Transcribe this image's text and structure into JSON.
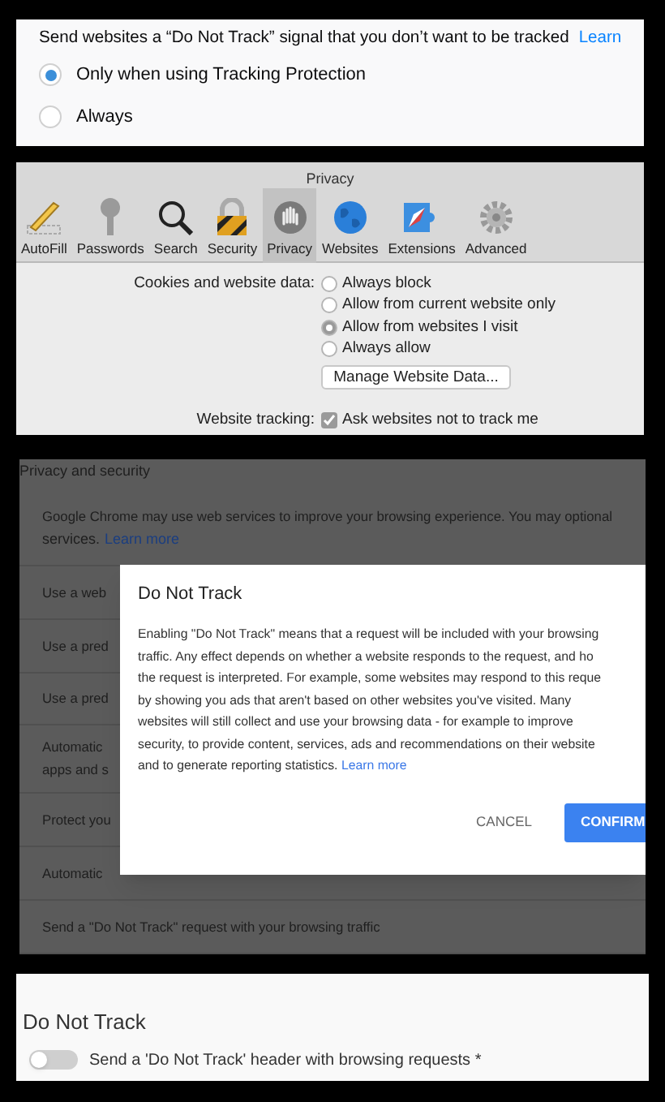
{
  "firefox": {
    "description": "Send websites a “Do Not Track” signal that you don’t want to be tracked",
    "link": "Learn",
    "options": [
      {
        "label": "Only when using Tracking Protection",
        "selected": true
      },
      {
        "label": "Always",
        "selected": false
      }
    ]
  },
  "safari": {
    "title": "Privacy",
    "tabs": [
      {
        "label": "AutoFill",
        "kind": "pencil",
        "selected": false
      },
      {
        "label": "Passwords",
        "kind": "key",
        "selected": false
      },
      {
        "label": "Search",
        "kind": "search",
        "selected": false
      },
      {
        "label": "Security",
        "kind": "lock",
        "selected": false
      },
      {
        "label": "Privacy",
        "kind": "hand",
        "selected": true
      },
      {
        "label": "Websites",
        "kind": "globe",
        "selected": false
      },
      {
        "label": "Extensions",
        "kind": "puzzle",
        "selected": false
      },
      {
        "label": "Advanced",
        "kind": "gear",
        "selected": false
      }
    ],
    "cookies_label": "Cookies and website data:",
    "cookie_options": [
      {
        "label": "Always block",
        "selected": false
      },
      {
        "label": "Allow from current website only",
        "selected": false
      },
      {
        "label": "Allow from websites I visit",
        "selected": true
      },
      {
        "label": "Always allow",
        "selected": false
      }
    ],
    "manage_button": "Manage Website Data...",
    "tracking_label": "Website tracking:",
    "tracking_option": {
      "label": "Ask websites not to track me",
      "checked": true
    }
  },
  "chrome": {
    "section_title": "Privacy and security",
    "rows": [
      {
        "lines": [
          "Google Chrome may use web services to improve your browsing experience. You may optional"
        ],
        "tail": "services.",
        "link": "Learn more"
      },
      {
        "lines": [
          "Use a web"
        ]
      },
      {
        "lines": [
          "Use a pred"
        ]
      },
      {
        "lines": [
          "Use a pred"
        ]
      },
      {
        "lines": [
          "Automatic",
          "apps and s"
        ]
      },
      {
        "lines": [
          "Protect you"
        ]
      },
      {
        "lines": [
          "Automatic"
        ]
      },
      {
        "lines": [
          "Send a \"Do Not Track\" request with your browsing traffic"
        ]
      }
    ],
    "dialog": {
      "title": "Do Not Track",
      "message_lines": [
        "Enabling \"Do Not Track\" means that a request will be included with your browsing",
        "traffic. Any effect depends on whether a website responds to the request, and ho",
        "the request is interpreted. For example, some websites may respond to this reque",
        "by showing you ads that aren't based on other websites you've visited. Many",
        "websites will still collect and use your browsing data - for example to improve",
        "security, to provide content, services, ads and recommendations on their website",
        "and to generate reporting statistics."
      ],
      "link": "Learn more",
      "cancel": "CANCEL",
      "confirm": "CONFIRM"
    }
  },
  "other": {
    "title": "Do Not Track",
    "toggle": {
      "label": "Send a 'Do Not Track' header with browsing requests *",
      "on": false
    }
  }
}
